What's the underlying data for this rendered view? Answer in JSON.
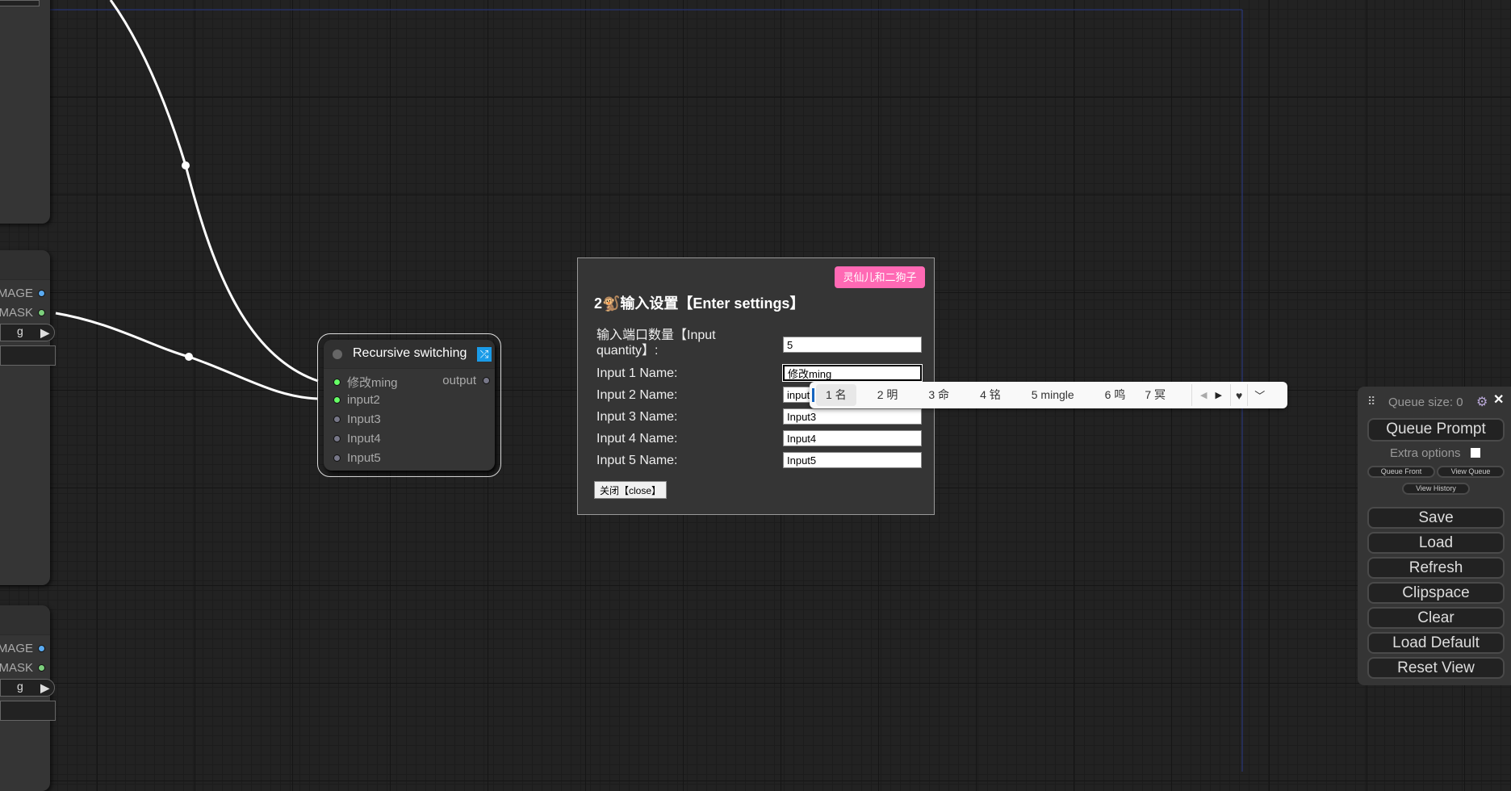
{
  "left_nodes": [
    {
      "outputs": []
    },
    {
      "outputs": [
        {
          "label": "MAGE",
          "color": "#5aaaf0"
        },
        {
          "label": "MASK",
          "color": "#7ccf7c"
        }
      ],
      "combo": "g"
    },
    {
      "outputs": [
        {
          "label": "MAGE",
          "color": "#5aaaf0"
        },
        {
          "label": "MASK",
          "color": "#7ccf7c"
        }
      ],
      "combo": "g"
    }
  ],
  "node": {
    "title": "Recursive switching",
    "title_icon": "shuffle-icon",
    "inputs": [
      {
        "label": "修改ming",
        "connected": true
      },
      {
        "label": "input2",
        "connected": true
      },
      {
        "label": "Input3",
        "connected": false
      },
      {
        "label": "Input4",
        "connected": false
      },
      {
        "label": "Input5",
        "connected": false
      }
    ],
    "output": "output"
  },
  "dialog": {
    "badge": "灵仙儿和二狗子",
    "badge_color": "#ff69b4",
    "title": "2🐒输入设置【Enter settings】",
    "quantity_label": "输入端口数量【Input quantity】:",
    "quantity_value": "5",
    "rows": [
      {
        "label": "Input 1 Name:",
        "value": "修改ming"
      },
      {
        "label": "Input 2 Name:",
        "value": "input"
      },
      {
        "label": "Input 3 Name:",
        "value": "Input3"
      },
      {
        "label": "Input 4 Name:",
        "value": "Input4"
      },
      {
        "label": "Input 5 Name:",
        "value": "Input5"
      }
    ],
    "close": "关闭【close】"
  },
  "ime": {
    "candidates": [
      "1 名",
      "2 明",
      "3 命",
      "4 铭",
      "5 mingle",
      "6 鸣",
      "7 冥"
    ]
  },
  "panel": {
    "queue_size": "Queue size: 0",
    "queue_prompt": "Queue Prompt",
    "extra_options": "Extra options",
    "queue_front": "Queue Front",
    "view_queue": "View Queue",
    "view_history": "View History",
    "buttons": [
      "Save",
      "Load",
      "Refresh",
      "Clipspace",
      "Clear",
      "Load Default",
      "Reset View"
    ]
  }
}
